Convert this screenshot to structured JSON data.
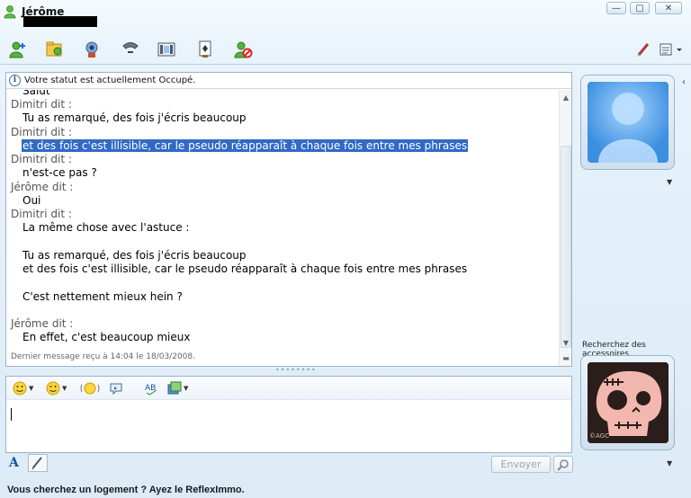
{
  "window": {
    "contact_name": "Jérôme",
    "minimize_glyph": "—",
    "maximize_glyph": "▢",
    "close_glyph": "✕"
  },
  "toolbar": {
    "icons": [
      "invite-contact-icon",
      "share-files-icon",
      "video-call-icon",
      "phone-call-icon",
      "activities-icon",
      "games-icon",
      "block-contact-icon",
      "paint-brush-icon",
      "display-menu-icon"
    ]
  },
  "conversation": {
    "status_message": "Votre statut est actuellement Occupé.",
    "info_glyph": "i",
    "messages": [
      {
        "kind": "body",
        "text": "Salut"
      },
      {
        "kind": "sender",
        "text": "Dimitri dit :"
      },
      {
        "kind": "body",
        "text": "Tu as remarqué, des fois j'écris beaucoup"
      },
      {
        "kind": "sender",
        "text": "Dimitri dit :"
      },
      {
        "kind": "body",
        "text": "et des fois c'est illisible, car le pseudo réapparaît à chaque fois entre mes phrases",
        "highlighted": true
      },
      {
        "kind": "sender",
        "text": "Dimitri dit :"
      },
      {
        "kind": "body",
        "text": "n'est-ce pas ?"
      },
      {
        "kind": "sender",
        "text": "Jérôme dit :"
      },
      {
        "kind": "body",
        "text": "Oui"
      },
      {
        "kind": "sender",
        "text": "Dimitri dit :"
      },
      {
        "kind": "body",
        "text": "La même chose avec l'astuce :"
      },
      {
        "kind": "body",
        "text": "Tu as remarqué, des fois j'écris beaucoup"
      },
      {
        "kind": "body",
        "text": "et des fois c'est illisible, car le pseudo réapparaît à chaque fois entre mes phrases"
      },
      {
        "kind": "body",
        "text": "C'est nettement mieux hein ?"
      },
      {
        "kind": "sender",
        "text": "Jérôme dit :"
      },
      {
        "kind": "body",
        "text": "En effet, c'est beaucoup mieux"
      }
    ],
    "last_message": "Dernier message reçu à 14:04 le 18/03/2008."
  },
  "compose": {
    "tools": [
      "emoticon-icon",
      "wink-icon",
      "nudge-icon",
      "voice-clip-icon",
      "spell-check-icon",
      "background-icon"
    ],
    "input_value": "",
    "font_glyph": "A",
    "send_label": "Envoyer",
    "splitter_glyph": "••••••••"
  },
  "sidebar": {
    "accessories_label": "Recherchez des accessoires",
    "avatar_watermark": "©AGC",
    "collapse_glyph": "‹",
    "dropdown_glyph": "▼"
  },
  "ad": {
    "text": "Vous cherchez un logement ? Ayez le ReflexImmo."
  },
  "colors": {
    "selection": "#316ac5",
    "sender_text": "#555555",
    "border": "#9db4c8"
  }
}
